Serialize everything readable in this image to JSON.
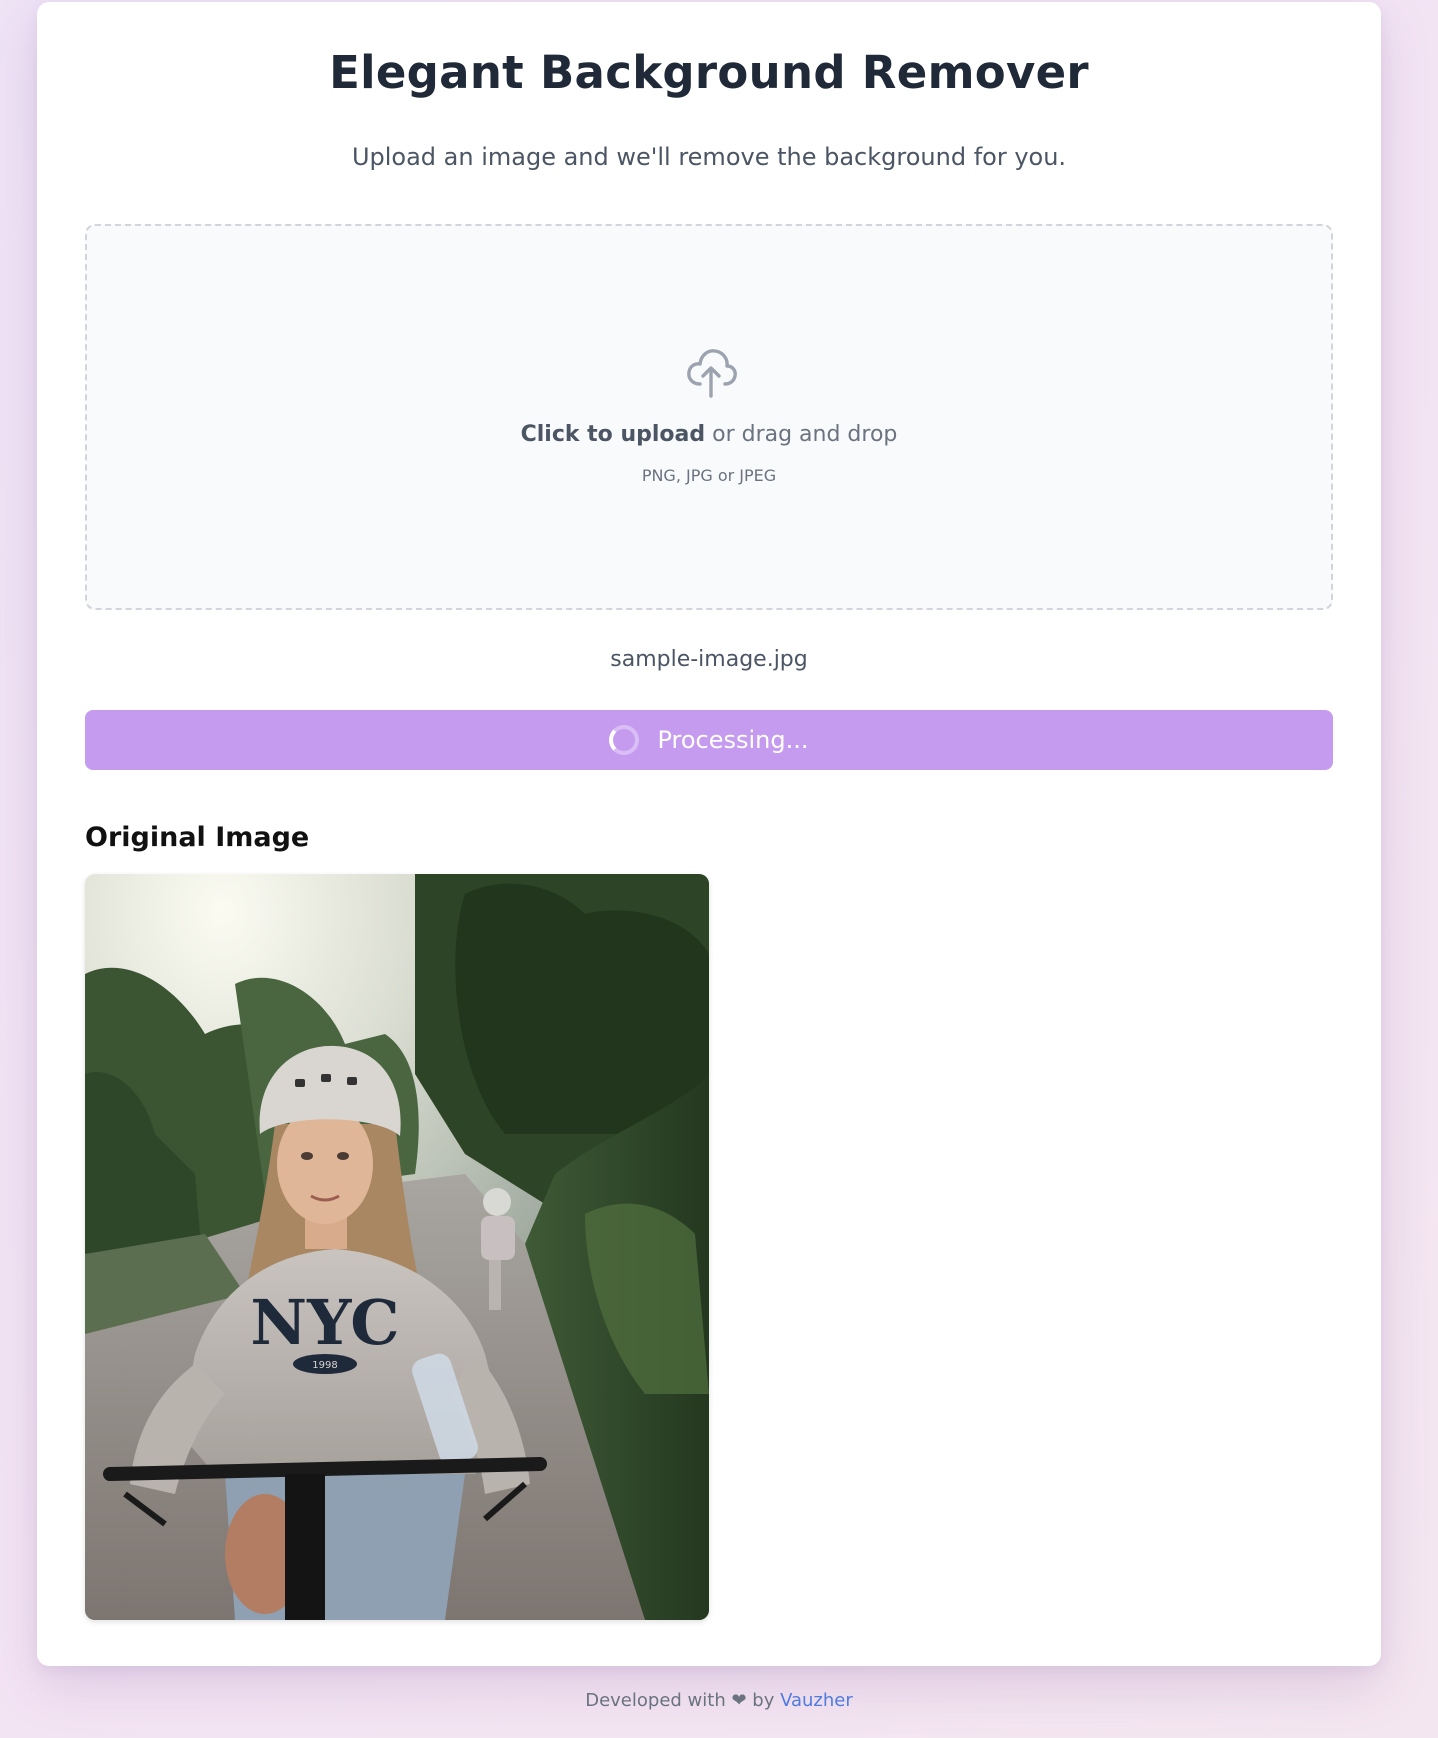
{
  "header": {
    "title": "Elegant Background Remover",
    "subtitle": "Upload an image and we'll remove the background for you."
  },
  "dropzone": {
    "click_label": "Click to upload",
    "drag_label": " or drag and drop",
    "formats": "PNG, JPG or JPEG",
    "icon": "cloud-upload-icon"
  },
  "file": {
    "name": "sample-image.jpg"
  },
  "process_button": {
    "label": "Processing...",
    "icon": "spinner-icon"
  },
  "original": {
    "heading": "Original Image",
    "photo_text": {
      "shirt": "NYC",
      "badge": "1998"
    }
  },
  "footer": {
    "prefix": "Developed with ",
    "heart": "❤",
    "by": " by ",
    "author": "Vauzher"
  },
  "colors": {
    "accent": "#c49bee",
    "link": "#4f7be0",
    "title": "#1f2937"
  }
}
